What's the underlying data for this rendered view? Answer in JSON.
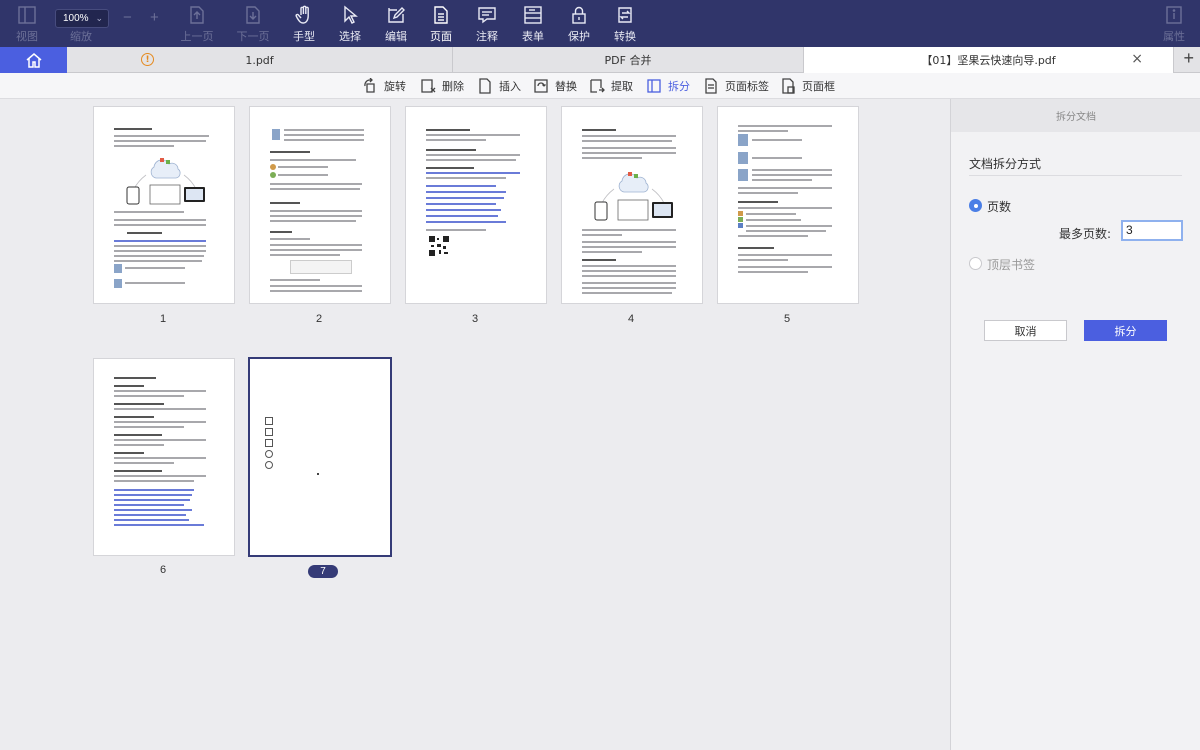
{
  "toolbar": {
    "zoom": "100%",
    "items": [
      {
        "label": "视图",
        "icon": "view-icon",
        "state": "disabled"
      },
      {
        "label": "缩放",
        "icon": "zoom-icon",
        "state": "disabled"
      },
      {
        "label": "上一页",
        "icon": "prev-page-icon",
        "state": "disabled"
      },
      {
        "label": "下一页",
        "icon": "next-page-icon",
        "state": "disabled"
      },
      {
        "label": "手型",
        "icon": "hand-icon",
        "state": "enabled"
      },
      {
        "label": "选择",
        "icon": "select-cursor-icon",
        "state": "enabled"
      },
      {
        "label": "编辑",
        "icon": "edit-icon",
        "state": "enabled"
      },
      {
        "label": "页面",
        "icon": "page-icon",
        "state": "active"
      },
      {
        "label": "注释",
        "icon": "comment-icon",
        "state": "enabled"
      },
      {
        "label": "表单",
        "icon": "form-icon",
        "state": "enabled"
      },
      {
        "label": "保护",
        "icon": "lock-icon",
        "state": "enabled"
      },
      {
        "label": "转换",
        "icon": "convert-icon",
        "state": "enabled"
      },
      {
        "label": "属性",
        "icon": "info-icon",
        "state": "disabled"
      }
    ]
  },
  "tabs": [
    {
      "label": "1.pdf",
      "warning": "!",
      "active": false
    },
    {
      "label": "PDF 合并",
      "active": false
    },
    {
      "label": "【01】坚果云快速向导.pdf",
      "active": true
    }
  ],
  "tab_close": "×",
  "tab_add": "+",
  "page_tools": [
    {
      "label": "旋转",
      "icon": "rotate-icon"
    },
    {
      "label": "删除",
      "icon": "delete-page-icon"
    },
    {
      "label": "插入",
      "icon": "insert-page-icon"
    },
    {
      "label": "替换",
      "icon": "replace-page-icon"
    },
    {
      "label": "提取",
      "icon": "extract-page-icon"
    },
    {
      "label": "拆分",
      "icon": "split-icon",
      "active": true
    },
    {
      "label": "页面标签",
      "icon": "page-label-icon"
    },
    {
      "label": "页面框",
      "icon": "page-box-icon"
    }
  ],
  "pages": [
    "1",
    "2",
    "3",
    "4",
    "5",
    "6",
    "7"
  ],
  "selected_page": "7",
  "right_panel": {
    "header": "拆分文档",
    "title": "文档拆分方式",
    "option_pages": "页数",
    "option_bookmarks": "顶层书签",
    "max_pages_label": "最多页数:",
    "max_pages_value": "3",
    "cancel_button": "取消",
    "split_button": "拆分"
  },
  "colors": {
    "toolbar_bg": "#30356a",
    "accent": "#4b5fe0",
    "selected_page": "#353b77"
  }
}
